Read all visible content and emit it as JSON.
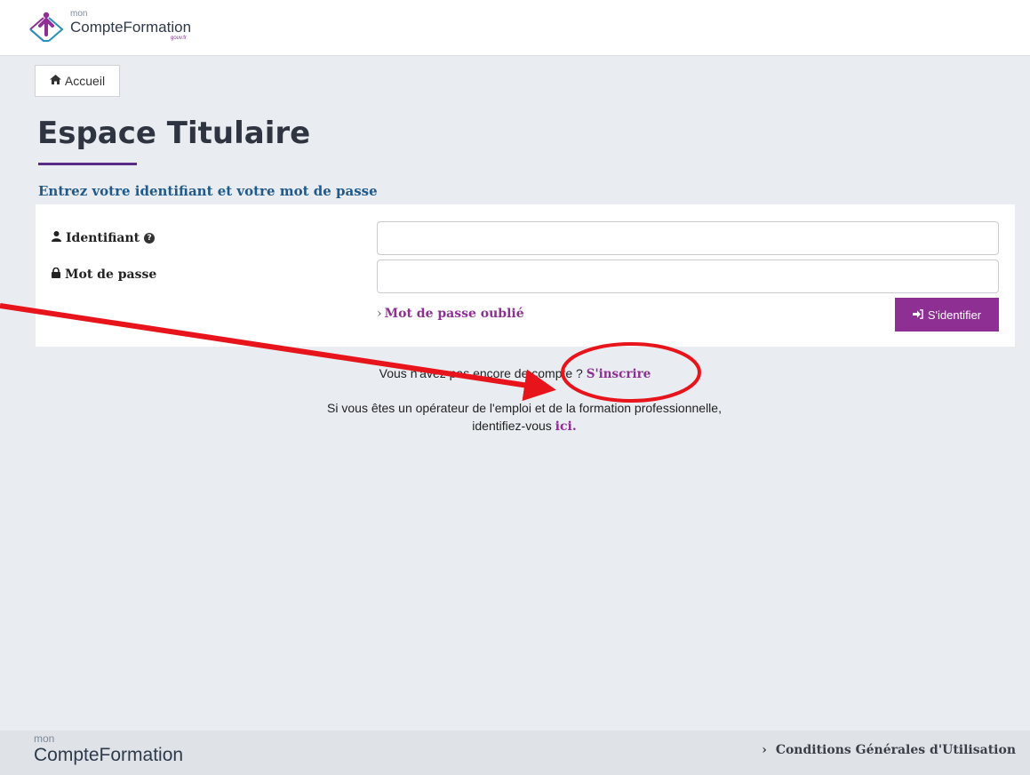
{
  "header": {
    "logo_mon": "mon",
    "logo_brand": "CompteFormation",
    "logo_gouv": "gouv.fr"
  },
  "nav": {
    "home_label": "Accueil"
  },
  "page": {
    "title": "Espace Titulaire",
    "form_heading": "Entrez votre identifiant et votre mot de passe"
  },
  "form": {
    "identifier_label": "Identifiant",
    "identifier_value": "",
    "password_label": "Mot de passe",
    "password_value": "",
    "forgot_link": "Mot de passe oublié",
    "submit_label": "S'identifier"
  },
  "signup": {
    "prompt": "Vous n'avez pas encore de compte ?",
    "link": "S'inscrire"
  },
  "operator": {
    "text_line1": "Si vous êtes un opérateur de l'emploi et de la formation professionnelle,",
    "text_line2": "identifiez-vous",
    "link": "ici."
  },
  "footer": {
    "logo_mon": "mon",
    "logo_brand": "CompteFormation",
    "cgu_link": "Conditions Générales d'Utilisation"
  },
  "colors": {
    "accent": "#8e2f94",
    "heading_blue": "#1f5a8a",
    "title_underline": "#5b2a86",
    "annotation_red": "#e8141b",
    "background": "#e9ecf1"
  },
  "icons": {
    "home": "home-icon",
    "user": "user-icon",
    "help": "question-circle-icon",
    "lock": "lock-icon",
    "login": "sign-in-icon",
    "chevron": "chevron-right-icon"
  }
}
